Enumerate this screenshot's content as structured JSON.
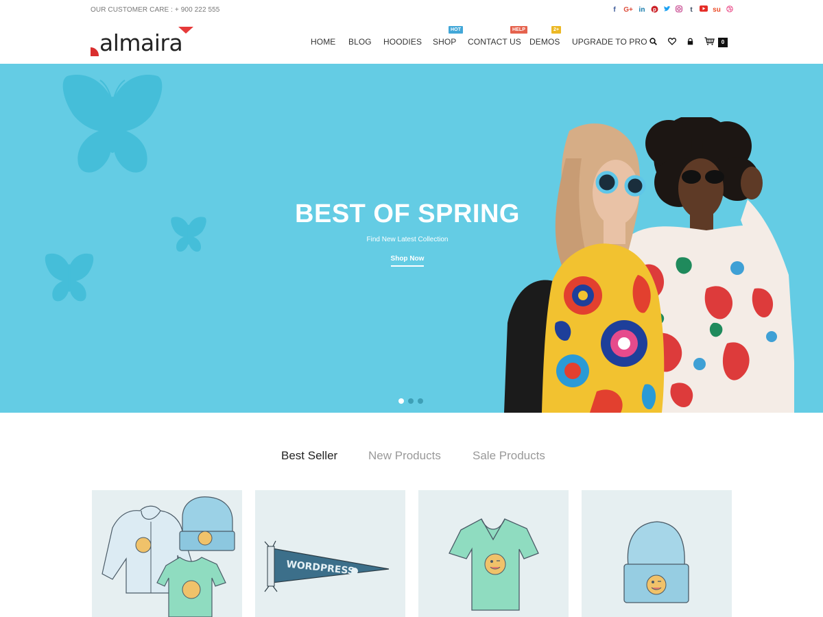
{
  "topbar": {
    "customer_care": "OUR CUSTOMER CARE : + 900 222 555",
    "socials": [
      {
        "icon": "facebook-icon",
        "glyph": "f",
        "color": "#3b5998"
      },
      {
        "icon": "google-plus-icon",
        "glyph": "G+",
        "color": "#dd4b39"
      },
      {
        "icon": "linkedin-icon",
        "glyph": "in",
        "color": "#0e76a8"
      },
      {
        "icon": "pinterest-icon",
        "glyph": "P",
        "color": "#cb2027"
      },
      {
        "icon": "twitter-icon",
        "glyph": "t",
        "color": "#1da1f2"
      },
      {
        "icon": "instagram-icon",
        "glyph": "◎",
        "color": "#c13584"
      },
      {
        "icon": "tumblr-icon",
        "glyph": "t",
        "color": "#35465c"
      },
      {
        "icon": "youtube-icon",
        "glyph": "▶",
        "color": "#e52d27"
      },
      {
        "icon": "stumbleupon-icon",
        "glyph": "su",
        "color": "#eb4924"
      },
      {
        "icon": "dribbble-icon",
        "glyph": "◍",
        "color": "#ea4c89"
      }
    ]
  },
  "header": {
    "logo_text": "almaira",
    "nav": [
      {
        "label": "HOME"
      },
      {
        "label": "BLOG"
      },
      {
        "label": "HOODIES"
      },
      {
        "label": "SHOP",
        "badge": "HOT"
      },
      {
        "label": "CONTACT US",
        "badge": "HELP"
      },
      {
        "label": "DEMOS",
        "badge": "2+"
      },
      {
        "label": "UPGRADE TO PRO"
      }
    ],
    "icons": [
      "search-icon",
      "heart-icon",
      "lock-icon",
      "cart-icon"
    ],
    "cart_count": "0"
  },
  "hero": {
    "title": "BEST OF SPRING",
    "subtitle": "Find New Latest Collection",
    "button": "Shop Now",
    "slides": 3,
    "active_slide": 1,
    "background": "#64cce4"
  },
  "tabs": [
    {
      "label": "Best Seller",
      "active": true
    },
    {
      "label": "New Products",
      "active": false
    },
    {
      "label": "Sale Products",
      "active": false
    }
  ],
  "products": [
    {
      "image": "hoodie-beanie-tshirt-set"
    },
    {
      "image": "wordpress-pennant"
    },
    {
      "image": "v-neck-tshirt"
    },
    {
      "image": "beanie"
    }
  ],
  "colors": {
    "accent": "#e63a3a",
    "hero_blue": "#64cce4",
    "text": "#333333"
  }
}
